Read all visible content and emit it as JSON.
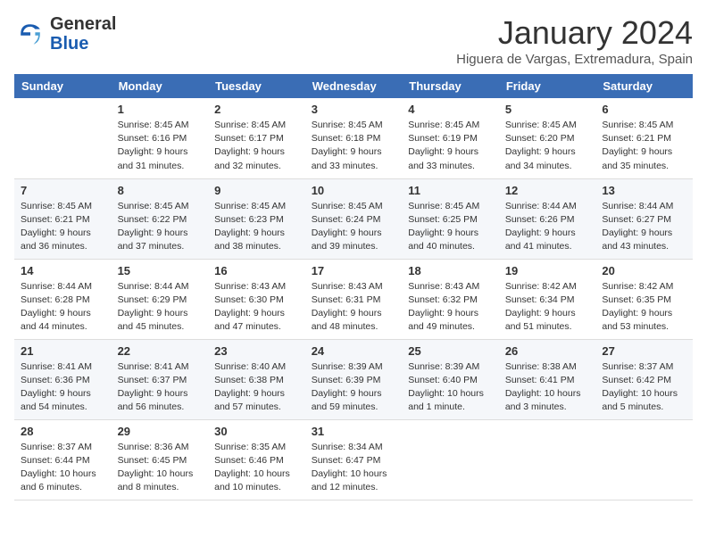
{
  "header": {
    "logo_general": "General",
    "logo_blue": "Blue",
    "month_title": "January 2024",
    "location": "Higuera de Vargas, Extremadura, Spain"
  },
  "columns": [
    "Sunday",
    "Monday",
    "Tuesday",
    "Wednesday",
    "Thursday",
    "Friday",
    "Saturday"
  ],
  "rows": [
    [
      {
        "day": "",
        "lines": []
      },
      {
        "day": "1",
        "lines": [
          "Sunrise: 8:45 AM",
          "Sunset: 6:16 PM",
          "Daylight: 9 hours",
          "and 31 minutes."
        ]
      },
      {
        "day": "2",
        "lines": [
          "Sunrise: 8:45 AM",
          "Sunset: 6:17 PM",
          "Daylight: 9 hours",
          "and 32 minutes."
        ]
      },
      {
        "day": "3",
        "lines": [
          "Sunrise: 8:45 AM",
          "Sunset: 6:18 PM",
          "Daylight: 9 hours",
          "and 33 minutes."
        ]
      },
      {
        "day": "4",
        "lines": [
          "Sunrise: 8:45 AM",
          "Sunset: 6:19 PM",
          "Daylight: 9 hours",
          "and 33 minutes."
        ]
      },
      {
        "day": "5",
        "lines": [
          "Sunrise: 8:45 AM",
          "Sunset: 6:20 PM",
          "Daylight: 9 hours",
          "and 34 minutes."
        ]
      },
      {
        "day": "6",
        "lines": [
          "Sunrise: 8:45 AM",
          "Sunset: 6:21 PM",
          "Daylight: 9 hours",
          "and 35 minutes."
        ]
      }
    ],
    [
      {
        "day": "7",
        "lines": [
          "Sunrise: 8:45 AM",
          "Sunset: 6:21 PM",
          "Daylight: 9 hours",
          "and 36 minutes."
        ]
      },
      {
        "day": "8",
        "lines": [
          "Sunrise: 8:45 AM",
          "Sunset: 6:22 PM",
          "Daylight: 9 hours",
          "and 37 minutes."
        ]
      },
      {
        "day": "9",
        "lines": [
          "Sunrise: 8:45 AM",
          "Sunset: 6:23 PM",
          "Daylight: 9 hours",
          "and 38 minutes."
        ]
      },
      {
        "day": "10",
        "lines": [
          "Sunrise: 8:45 AM",
          "Sunset: 6:24 PM",
          "Daylight: 9 hours",
          "and 39 minutes."
        ]
      },
      {
        "day": "11",
        "lines": [
          "Sunrise: 8:45 AM",
          "Sunset: 6:25 PM",
          "Daylight: 9 hours",
          "and 40 minutes."
        ]
      },
      {
        "day": "12",
        "lines": [
          "Sunrise: 8:44 AM",
          "Sunset: 6:26 PM",
          "Daylight: 9 hours",
          "and 41 minutes."
        ]
      },
      {
        "day": "13",
        "lines": [
          "Sunrise: 8:44 AM",
          "Sunset: 6:27 PM",
          "Daylight: 9 hours",
          "and 43 minutes."
        ]
      }
    ],
    [
      {
        "day": "14",
        "lines": [
          "Sunrise: 8:44 AM",
          "Sunset: 6:28 PM",
          "Daylight: 9 hours",
          "and 44 minutes."
        ]
      },
      {
        "day": "15",
        "lines": [
          "Sunrise: 8:44 AM",
          "Sunset: 6:29 PM",
          "Daylight: 9 hours",
          "and 45 minutes."
        ]
      },
      {
        "day": "16",
        "lines": [
          "Sunrise: 8:43 AM",
          "Sunset: 6:30 PM",
          "Daylight: 9 hours",
          "and 47 minutes."
        ]
      },
      {
        "day": "17",
        "lines": [
          "Sunrise: 8:43 AM",
          "Sunset: 6:31 PM",
          "Daylight: 9 hours",
          "and 48 minutes."
        ]
      },
      {
        "day": "18",
        "lines": [
          "Sunrise: 8:43 AM",
          "Sunset: 6:32 PM",
          "Daylight: 9 hours",
          "and 49 minutes."
        ]
      },
      {
        "day": "19",
        "lines": [
          "Sunrise: 8:42 AM",
          "Sunset: 6:34 PM",
          "Daylight: 9 hours",
          "and 51 minutes."
        ]
      },
      {
        "day": "20",
        "lines": [
          "Sunrise: 8:42 AM",
          "Sunset: 6:35 PM",
          "Daylight: 9 hours",
          "and 53 minutes."
        ]
      }
    ],
    [
      {
        "day": "21",
        "lines": [
          "Sunrise: 8:41 AM",
          "Sunset: 6:36 PM",
          "Daylight: 9 hours",
          "and 54 minutes."
        ]
      },
      {
        "day": "22",
        "lines": [
          "Sunrise: 8:41 AM",
          "Sunset: 6:37 PM",
          "Daylight: 9 hours",
          "and 56 minutes."
        ]
      },
      {
        "day": "23",
        "lines": [
          "Sunrise: 8:40 AM",
          "Sunset: 6:38 PM",
          "Daylight: 9 hours",
          "and 57 minutes."
        ]
      },
      {
        "day": "24",
        "lines": [
          "Sunrise: 8:39 AM",
          "Sunset: 6:39 PM",
          "Daylight: 9 hours",
          "and 59 minutes."
        ]
      },
      {
        "day": "25",
        "lines": [
          "Sunrise: 8:39 AM",
          "Sunset: 6:40 PM",
          "Daylight: 10 hours",
          "and 1 minute."
        ]
      },
      {
        "day": "26",
        "lines": [
          "Sunrise: 8:38 AM",
          "Sunset: 6:41 PM",
          "Daylight: 10 hours",
          "and 3 minutes."
        ]
      },
      {
        "day": "27",
        "lines": [
          "Sunrise: 8:37 AM",
          "Sunset: 6:42 PM",
          "Daylight: 10 hours",
          "and 5 minutes."
        ]
      }
    ],
    [
      {
        "day": "28",
        "lines": [
          "Sunrise: 8:37 AM",
          "Sunset: 6:44 PM",
          "Daylight: 10 hours",
          "and 6 minutes."
        ]
      },
      {
        "day": "29",
        "lines": [
          "Sunrise: 8:36 AM",
          "Sunset: 6:45 PM",
          "Daylight: 10 hours",
          "and 8 minutes."
        ]
      },
      {
        "day": "30",
        "lines": [
          "Sunrise: 8:35 AM",
          "Sunset: 6:46 PM",
          "Daylight: 10 hours",
          "and 10 minutes."
        ]
      },
      {
        "day": "31",
        "lines": [
          "Sunrise: 8:34 AM",
          "Sunset: 6:47 PM",
          "Daylight: 10 hours",
          "and 12 minutes."
        ]
      },
      {
        "day": "",
        "lines": []
      },
      {
        "day": "",
        "lines": []
      },
      {
        "day": "",
        "lines": []
      }
    ]
  ]
}
